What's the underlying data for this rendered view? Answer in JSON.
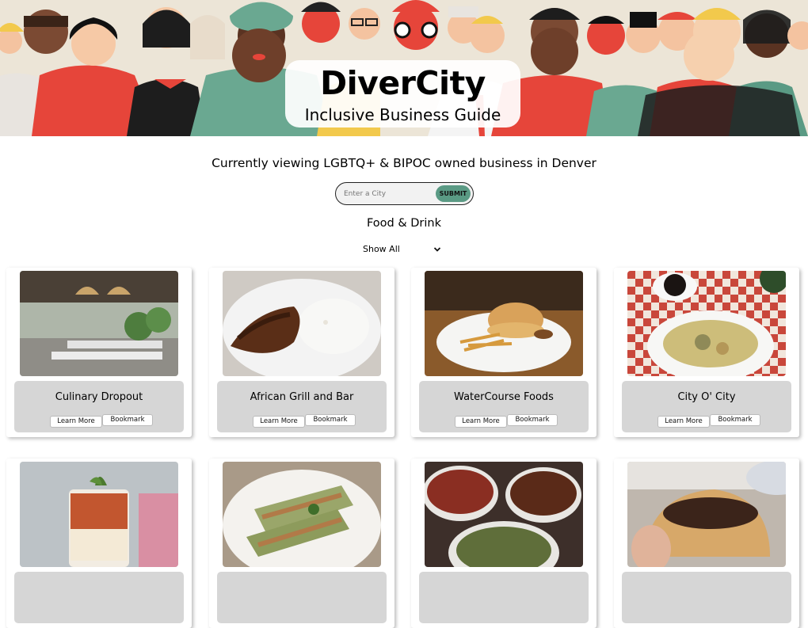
{
  "header": {
    "title": "DiverCity",
    "subtitle": "Inclusive Business Guide"
  },
  "viewing_text": "Currently viewing LGBTQ+ & BIPOC owned business in Denver",
  "search": {
    "placeholder": "Enter a City",
    "value": "",
    "submit_label": "SUBMIT"
  },
  "category_title": "Food & Drink",
  "filter": {
    "selected": "Show All",
    "icon": "chevron-down-icon"
  },
  "card_buttons": {
    "learn_more": "Learn More",
    "bookmark": "Bookmark"
  },
  "businesses": [
    {
      "name": "Culinary Dropout",
      "photo": "restaurant-patio"
    },
    {
      "name": "African Grill and Bar",
      "photo": "plate-meat-rice"
    },
    {
      "name": "WaterCourse Foods",
      "photo": "burger-fries"
    },
    {
      "name": "City O' City",
      "photo": "checkered-table-bowls"
    },
    {
      "name": "",
      "photo": "layered-cocktail"
    },
    {
      "name": "",
      "photo": "stuffed-rolls-dish"
    },
    {
      "name": "",
      "photo": "takeout-containers"
    },
    {
      "name": "",
      "photo": "hand-held-pastry"
    }
  ],
  "colors": {
    "submit": "#5a9a84",
    "info_panel": "#d6d6d6",
    "hero_red": "#e6453a",
    "hero_teal": "#6aa891"
  }
}
